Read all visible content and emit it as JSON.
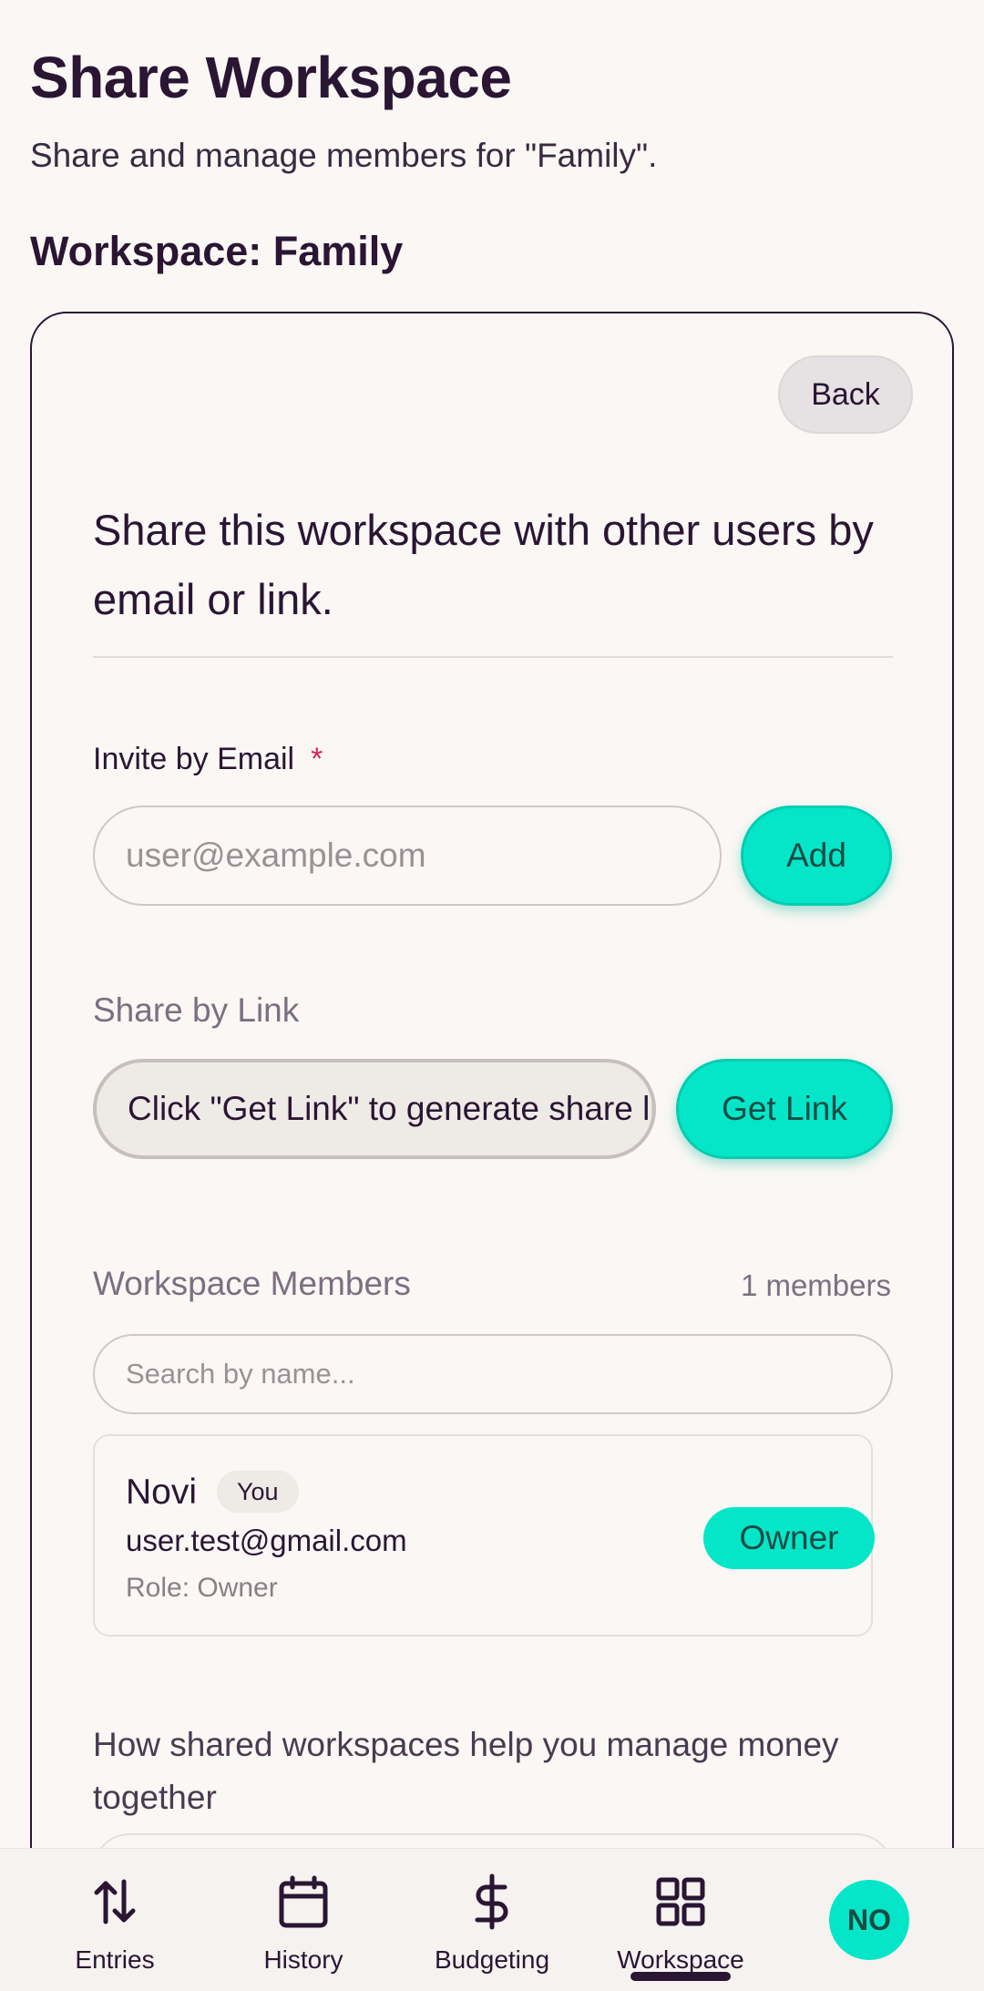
{
  "header": {
    "title": "Share Workspace",
    "subtitle": "Share and manage members for \"Family\".",
    "workspace_heading": "Workspace: Family"
  },
  "card": {
    "back_label": "Back",
    "intro": "Share this workspace with other users by email or link.",
    "invite": {
      "label": "Invite by Email",
      "required_mark": "*",
      "placeholder": "user@example.com",
      "value": "",
      "add_label": "Add"
    },
    "share_link": {
      "label": "Share by Link",
      "field_text": "Click \"Get Link\" to generate share link",
      "button_label": "Get Link"
    },
    "members": {
      "heading": "Workspace Members",
      "count_text": "1 members",
      "search_placeholder": "Search by name...",
      "items": [
        {
          "name": "Novi",
          "you_badge": "You",
          "email": "user.test@gmail.com",
          "role_text": "Role: Owner",
          "role_badge": "Owner"
        }
      ]
    },
    "help_heading": "How shared workspaces help you manage money together"
  },
  "bottom_nav": {
    "items": [
      {
        "label": "Entries",
        "icon": "arrows-up-down-icon"
      },
      {
        "label": "History",
        "icon": "calendar-icon"
      },
      {
        "label": "Budgeting",
        "icon": "dollar-icon"
      },
      {
        "label": "Workspace",
        "icon": "grid-icon",
        "active": true
      }
    ],
    "profile_initials": "NO"
  },
  "colors": {
    "accent": "#05e6c8",
    "text": "#2a1533",
    "background": "#faf7f4",
    "required": "#d0265a"
  }
}
